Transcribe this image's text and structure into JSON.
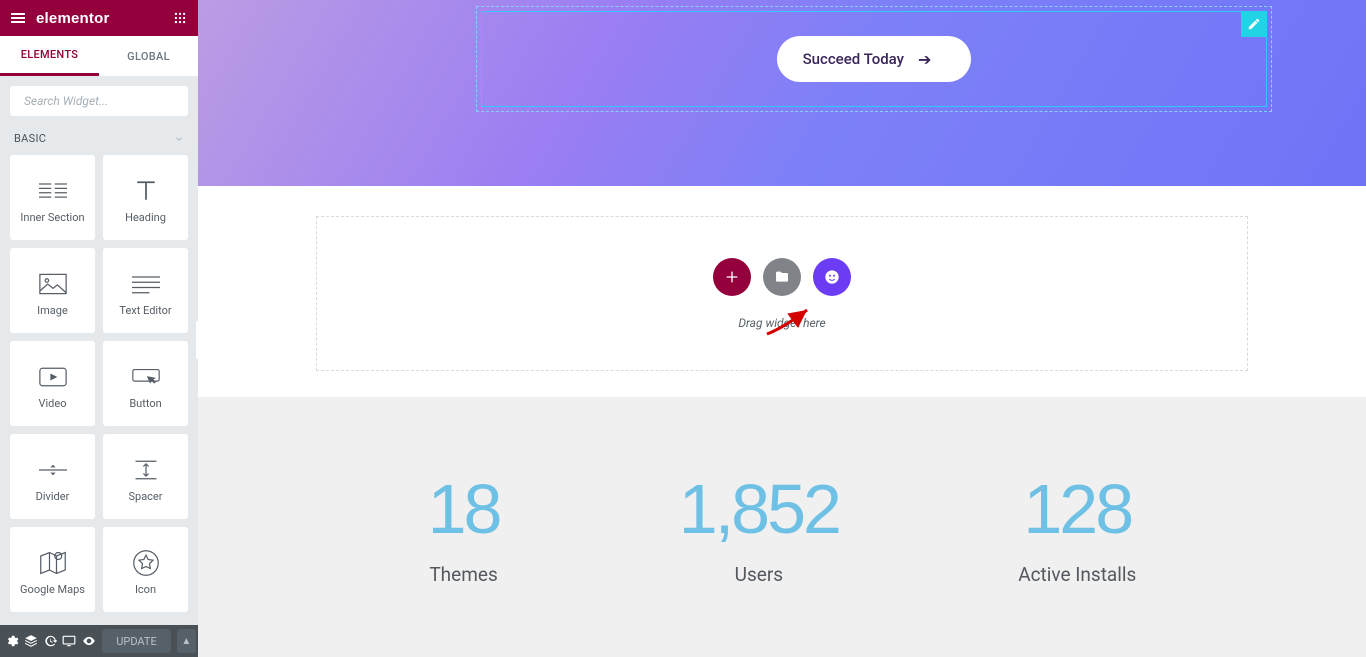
{
  "header": {
    "brand": "elementor"
  },
  "tabs": {
    "elements": "ELEMENTS",
    "global": "GLOBAL"
  },
  "search": {
    "placeholder": "Search Widget..."
  },
  "group": {
    "basic": "BASIC"
  },
  "widgets": {
    "inner_section": "Inner Section",
    "heading": "Heading",
    "image": "Image",
    "text_editor": "Text Editor",
    "video": "Video",
    "button": "Button",
    "divider": "Divider",
    "spacer": "Spacer",
    "google_maps": "Google Maps",
    "icon": "Icon"
  },
  "footer": {
    "update": "UPDATE"
  },
  "hero": {
    "button_text": "Succeed Today"
  },
  "new_section": {
    "hint": "Drag widget here"
  },
  "stats": [
    {
      "value": "18",
      "label": "Themes"
    },
    {
      "value": "1,852",
      "label": "Users"
    },
    {
      "value": "128",
      "label": "Active Installs"
    }
  ],
  "colors": {
    "brand": "#93003c",
    "accent": "#6ec1e4"
  }
}
